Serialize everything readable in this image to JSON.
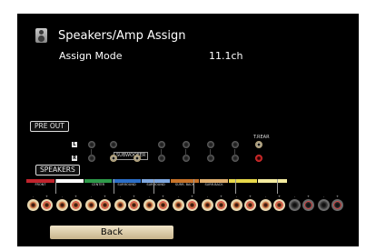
{
  "header": {
    "icon": "speaker-icon",
    "title": "Speakers/Amp Assign"
  },
  "assign_mode": {
    "label": "Assign Mode",
    "value": "11.1ch"
  },
  "labels": {
    "pre_out": "PRE OUT",
    "speakers": "SPEAKERS",
    "subwoofer": "SUBWOOFER",
    "t_rear": "T.REAR",
    "left": "L",
    "right": "R",
    "plus": "+",
    "minus": "-"
  },
  "channels": [
    {
      "label": "FRONT",
      "color": "#c0242d"
    },
    {
      "label": "FRONT",
      "color": "#ffffff"
    },
    {
      "label": "CENTER",
      "color": "#2e9a4a"
    },
    {
      "label": "SURROUND",
      "color": "#2c6fc8"
    },
    {
      "label": "SURROUND",
      "color": "#7fa8e0"
    },
    {
      "label": "SURR. BACK",
      "color": "#c8742a"
    },
    {
      "label": "SURR.BACK",
      "color": "#e0b070"
    },
    {
      "label": "T.FRONT",
      "color": "#e8d84a"
    },
    {
      "label": "T.FRONT",
      "color": "#f4eca0"
    }
  ],
  "buttons": {
    "back": "Back"
  }
}
